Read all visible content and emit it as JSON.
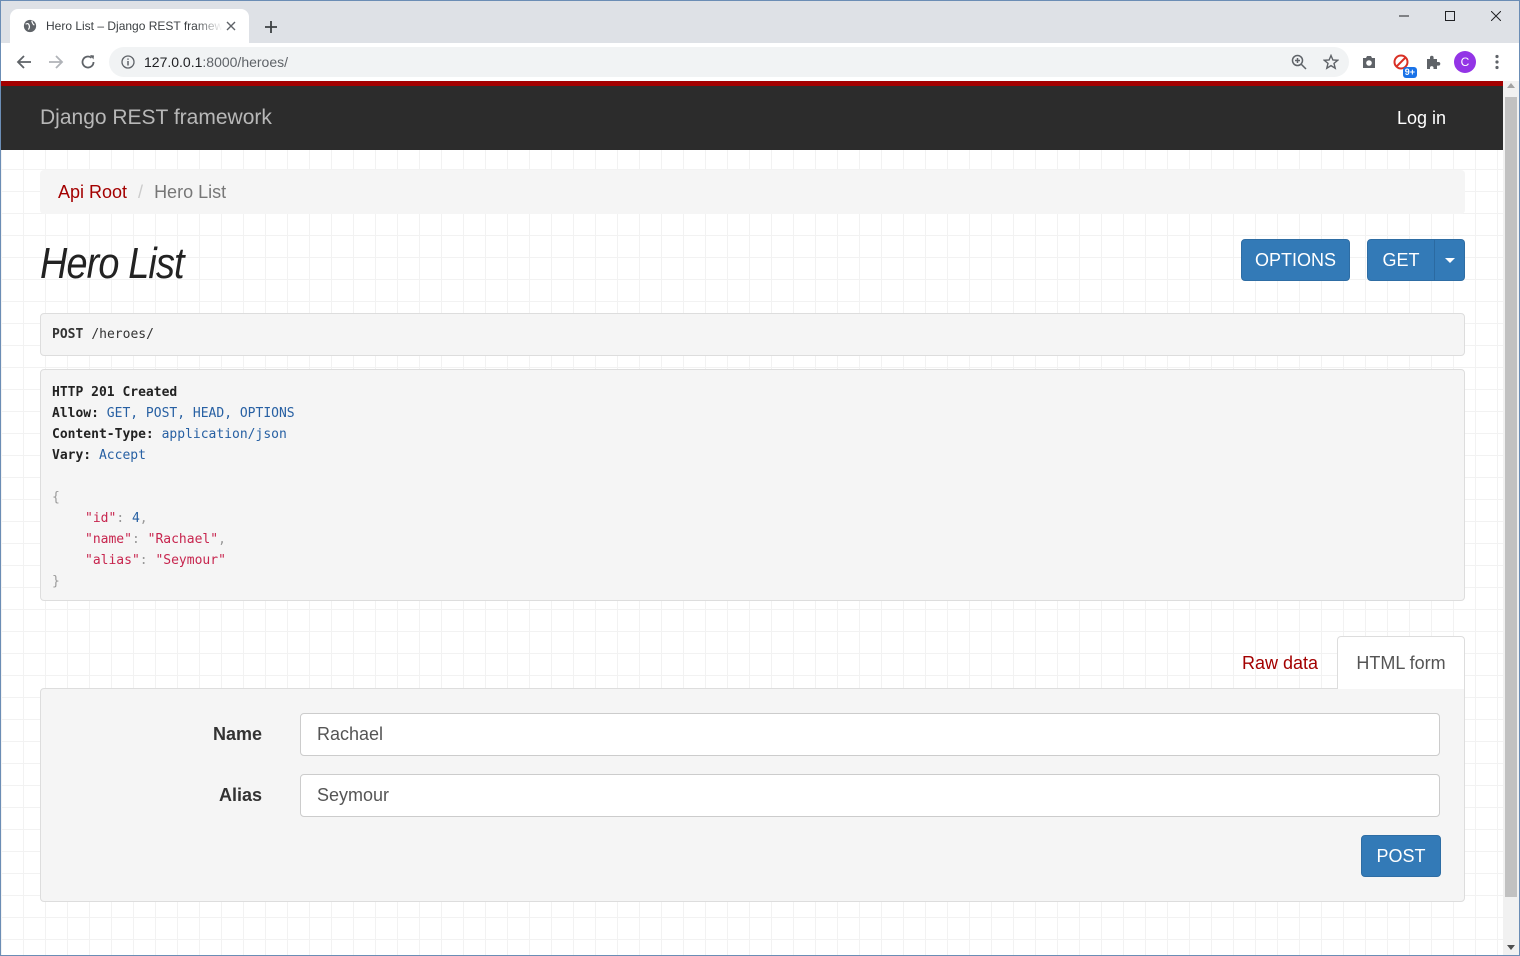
{
  "browser": {
    "tab_title": "Hero List – Django REST framework",
    "url_host": "127.0.0.1",
    "url_rest": ":8000/heroes/",
    "profile_initial": "C",
    "extension_badge": "9+"
  },
  "navbar": {
    "brand": "Django REST framework",
    "login": "Log in"
  },
  "breadcrumb": {
    "root": "Api Root",
    "separator": "/",
    "current": "Hero List"
  },
  "page": {
    "title": "Hero List",
    "options_label": "OPTIONS",
    "get_label": "GET"
  },
  "request": {
    "method": "POST",
    "path": "/heroes/"
  },
  "response": {
    "status": "HTTP 201 Created",
    "headers": [
      {
        "name": "Allow:",
        "value": "GET, POST, HEAD, OPTIONS"
      },
      {
        "name": "Content-Type:",
        "value": "application/json"
      },
      {
        "name": "Vary:",
        "value": "Accept"
      }
    ],
    "body": {
      "open": "{",
      "close": "}",
      "fields": [
        {
          "key": "\"id\"",
          "value": "4",
          "type": "number",
          "comma": ","
        },
        {
          "key": "\"name\"",
          "value": "\"Rachael\"",
          "type": "string",
          "comma": ","
        },
        {
          "key": "\"alias\"",
          "value": "\"Seymour\"",
          "type": "string",
          "comma": ""
        }
      ]
    }
  },
  "form": {
    "tab_raw": "Raw data",
    "tab_html": "HTML form",
    "name_label": "Name",
    "name_value": "Rachael",
    "alias_label": "Alias",
    "alias_value": "Seymour",
    "submit_label": "POST"
  }
}
